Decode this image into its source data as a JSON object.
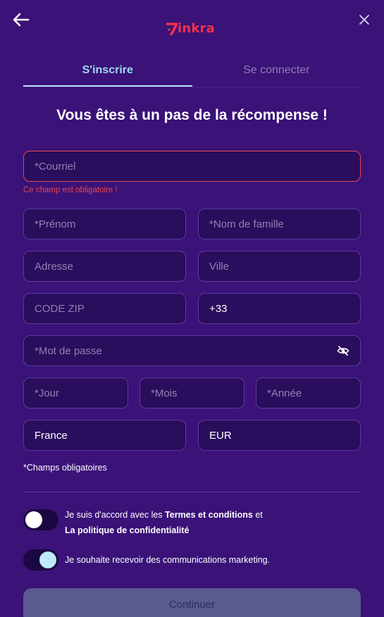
{
  "header": {
    "logo_text": "inkra",
    "back_icon": "arrow-left-icon",
    "close_icon": "close-icon"
  },
  "tabs": [
    {
      "label": "S'inscrire",
      "active": true
    },
    {
      "label": "Se connecter",
      "active": false
    }
  ],
  "headline": "Vous êtes à un pas de la récompense !",
  "form": {
    "email_placeholder": "*Courriel",
    "email_error": "Ce champ est obligatoire !",
    "firstname_placeholder": "*Prénom",
    "lastname_placeholder": "*Nom de famille",
    "address_placeholder": "Adresse",
    "city_placeholder": "Ville",
    "zip_placeholder": "CODE ZIP",
    "phone_prefix": "+33",
    "password_placeholder": "*Mot de passe",
    "day_placeholder": "*Jour",
    "month_placeholder": "*Mois",
    "year_placeholder": "*Année",
    "country_value": "France",
    "currency_value": "EUR",
    "required_note": "*Champs obligatoires"
  },
  "consents": {
    "terms_prefix": "Je suis d'accord avec les ",
    "terms_link": "Termes et conditions",
    "terms_and": " et",
    "privacy_link": "La politique de confidentialité",
    "terms_on": false,
    "marketing_label": "Je souhaite recevoir des communications marketing.",
    "marketing_on": true
  },
  "continue_label": "Continuer",
  "colors": {
    "background": "#3a1278",
    "field_bg": "#2a0d5c",
    "error": "#e7474a",
    "tab_active": "#9fd9f3",
    "brand": "#f2324b"
  }
}
